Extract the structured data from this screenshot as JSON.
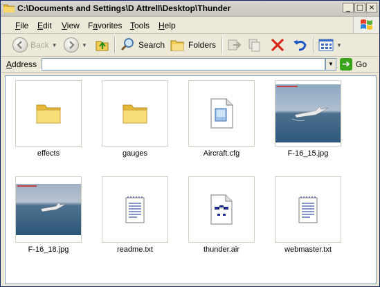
{
  "window": {
    "title": "C:\\Documents and Settings\\D Attrell\\Desktop\\Thunder",
    "controls": {
      "minimize": "_",
      "maximize": "□",
      "close": "×"
    }
  },
  "menu": {
    "items": [
      {
        "label": "File",
        "underline": "F",
        "rest": "ile"
      },
      {
        "label": "Edit",
        "underline": "E",
        "rest": "dit"
      },
      {
        "label": "View",
        "underline": "V",
        "rest": "iew"
      },
      {
        "label": "Favorites",
        "underline": "a",
        "pre": "F",
        "rest": "vorites"
      },
      {
        "label": "Tools",
        "underline": "T",
        "rest": "ools"
      },
      {
        "label": "Help",
        "underline": "H",
        "rest": "elp"
      }
    ]
  },
  "toolbar": {
    "back_label": "Back",
    "search_label": "Search",
    "folders_label": "Folders"
  },
  "address": {
    "label_u": "A",
    "label_rest": "ddress",
    "value": "",
    "go_label": "Go"
  },
  "files": [
    {
      "name": "effects",
      "type": "folder"
    },
    {
      "name": "gauges",
      "type": "folder"
    },
    {
      "name": "Aircraft.cfg",
      "type": "cfg"
    },
    {
      "name": "F-16_15.jpg",
      "type": "jpg"
    },
    {
      "name": "F-16_18.jpg",
      "type": "jpg"
    },
    {
      "name": "readme.txt",
      "type": "txt"
    },
    {
      "name": "thunder.air",
      "type": "air"
    },
    {
      "name": "webmaster.txt",
      "type": "txt"
    }
  ],
  "colors": {
    "address_border": "#7f9db9",
    "delete_red": "#d8261b",
    "undo_blue": "#1c56c4",
    "go_green": "#3aa31a",
    "folder_yellow": "#f5d46a"
  }
}
